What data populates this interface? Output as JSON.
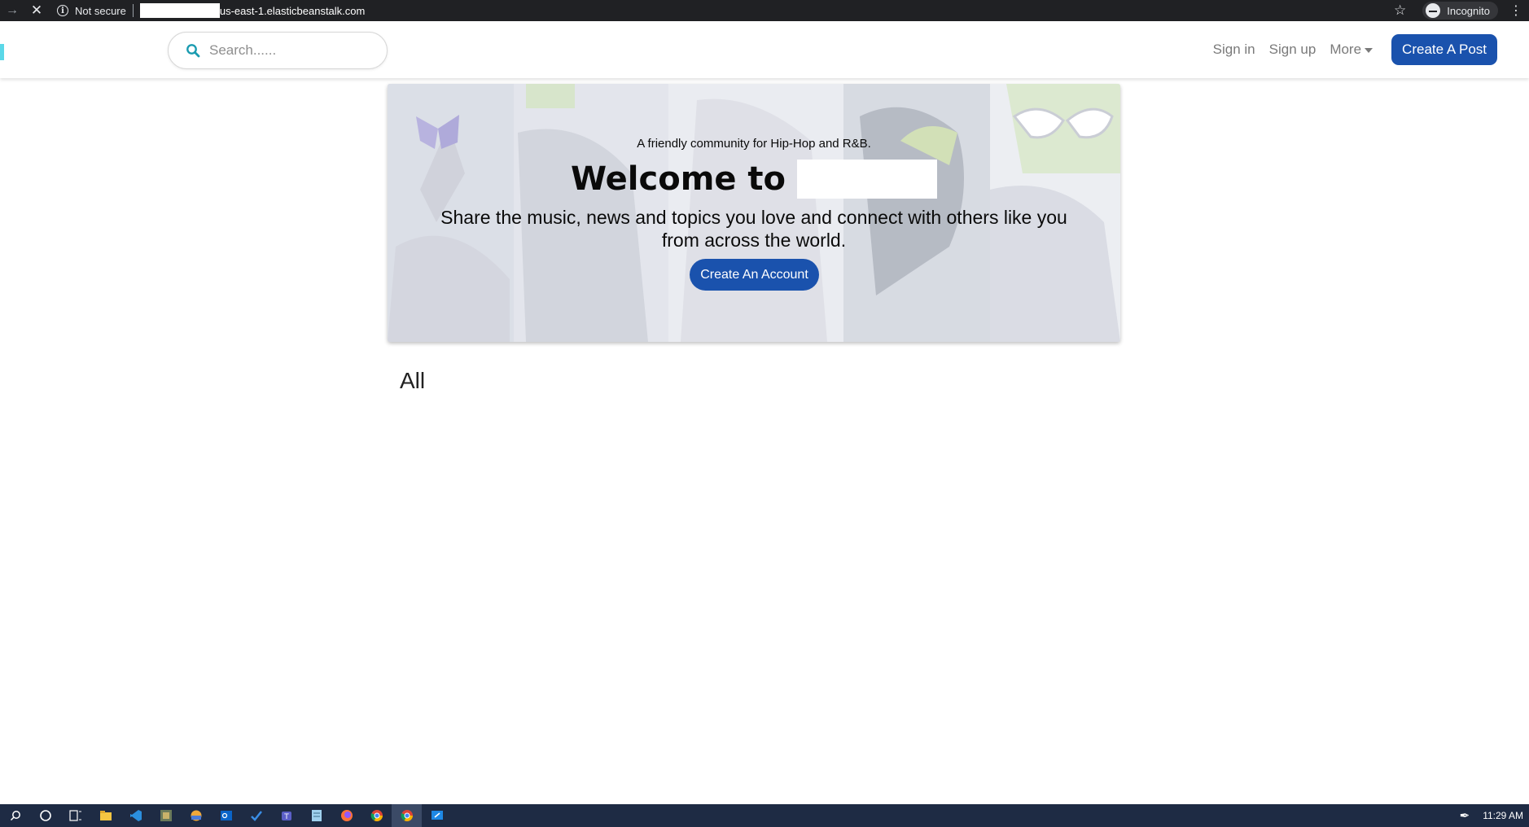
{
  "browser": {
    "back_icon": "arrow-right-icon",
    "close_icon": "close-icon",
    "security_label": "Not secure",
    "url_suffix": "us-east-1.elasticbeanstalk.com",
    "incognito_label": "Incognito"
  },
  "header": {
    "search": {
      "placeholder": "Search......"
    },
    "links": {
      "sign_in": "Sign in",
      "sign_up": "Sign up",
      "more": "More"
    },
    "create_post_label": "Create A Post",
    "accent_color": "#1a52ad"
  },
  "hero": {
    "tagline": "A friendly community for Hip-Hop and R&B.",
    "welcome": "Welcome to",
    "description": "Share the music, news and topics you love and connect with others like you from across the world.",
    "cta_label": "Create An Account"
  },
  "main": {
    "section_title": "All"
  },
  "taskbar": {
    "time": "11:29 AM"
  }
}
